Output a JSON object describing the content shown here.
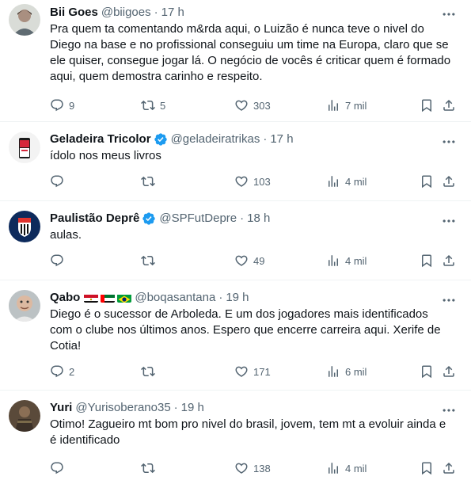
{
  "tweets": [
    {
      "name": "Bii Goes",
      "handle": "@biigoes",
      "time": "17 h",
      "text": "Pra quem ta comentando m&rda aqui, o Luizão é nunca teve o nivel do\nDiego na base e no profissional conseguiu um time na Europa, claro que se\nele quiser, consegue jogar lá. O negócio de vocês é criticar quem é formado\naqui, quem demostra carinho e respeito.",
      "replies": "9",
      "retweets": "5",
      "likes": "303",
      "views": "7 mil"
    },
    {
      "name": "Geladeira Tricolor",
      "handle": "@geladeiratrikas",
      "time": "17 h",
      "text": "ídolo nos meus livros",
      "replies": "",
      "retweets": "",
      "likes": "103",
      "views": "4 mil"
    },
    {
      "name": "Paulistão Deprê",
      "handle": "@SPFutDepre",
      "time": "18 h",
      "text": "aulas.",
      "replies": "",
      "retweets": "",
      "likes": "49",
      "views": "4 mil"
    },
    {
      "name": "Qabo",
      "handle": "@boqasantana",
      "time": "19 h",
      "text": "Diego é o sucessor de Arboleda. E um dos jogadores mais identificados\ncom o clube nos últimos anos. Espero que encerre carreira aqui. Xerife de\nCotia!",
      "replies": "2",
      "retweets": "",
      "likes": "171",
      "views": "6 mil"
    },
    {
      "name": "Yuri",
      "handle": "@Yurisoberano35",
      "time": "19 h",
      "text": "Otimo! Zagueiro mt bom pro nivel do brasil, jovem, tem mt a evoluir ainda e\né identificado",
      "replies": "",
      "retweets": "",
      "likes": "138",
      "views": "4 mil"
    }
  ],
  "separator": "·",
  "icons": {
    "reply": "reply-icon",
    "retweet": "retweet-icon",
    "like": "heart-icon",
    "views": "views-icon",
    "bookmark": "bookmark-icon",
    "share": "share-icon",
    "more": "more-icon",
    "verified": "verified-badge-icon"
  },
  "colors": {
    "text": "#0f1419",
    "muted": "#536471",
    "verified": "#1d9bf0",
    "divider": "#eff3f4"
  }
}
